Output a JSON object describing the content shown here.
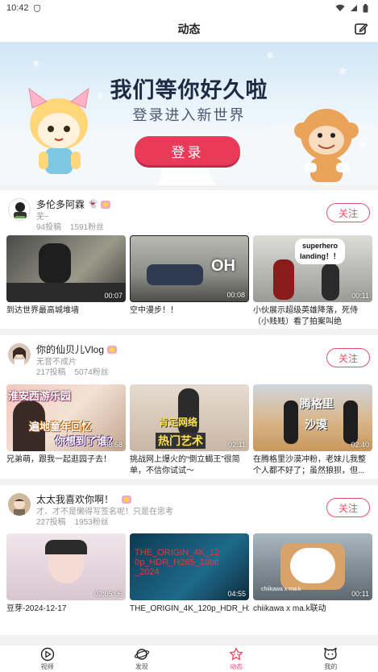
{
  "status": {
    "time": "10:42"
  },
  "header": {
    "title": "动态"
  },
  "banner": {
    "headline": "我们等你好久啦",
    "subline": "登录进入新世界",
    "login_label": "登录"
  },
  "cards": [
    {
      "name": "多伦多阿霖",
      "signature": "芜~",
      "posts": "94投稿",
      "fans": "1591粉丝",
      "follow": "关注",
      "videos": [
        {
          "duration": "00:07",
          "title": "到达世界最高城堆墙"
        },
        {
          "duration": "00:08",
          "title": "空中漫步！！",
          "overlay": "OH"
        },
        {
          "duration": "00:11",
          "title": "小伙展示超级英雄降落，死侍（小贱贱）看了拍案叫绝",
          "overlay": "superhero landing！！"
        }
      ]
    },
    {
      "name": "你的仙贝儿Vlog",
      "signature": "无音不成片",
      "posts": "217投稿",
      "fans": "5074粉丝",
      "follow": "关注",
      "videos": [
        {
          "duration": "03:58",
          "title": "兄弟萌，跟我一起逛园子去！",
          "overlay": "淮安西游乐园",
          "overlay2": "遍地童年回忆",
          "overlay3": "你想到了谁？"
        },
        {
          "duration": "02:11",
          "title": "挑战网上爆火的“倒立蝎王”很简单，不信你试试～",
          "overlay": "肯定网络",
          "overlay2": "热门艺术"
        },
        {
          "duration": "02:40",
          "title": "在腾格里沙漠冲粉，老妹儿我整个人都不好了；虽然狼狈，但...",
          "overlay": "腾格里",
          "overlay2": "沙漠"
        }
      ]
    },
    {
      "name": "太太我喜欢你啊！",
      "signature": "才、才不是懒得写签名呢！只是在思考",
      "posts": "227投稿",
      "fans": "1953粉丝",
      "follow": "关注",
      "videos": [
        {
          "duration": "02:05:06",
          "title": "豆芽-2024-12-17"
        },
        {
          "duration": "04:55",
          "title": "THE_ORIGIN_4K_120p_HDR_H265_10bit_2024",
          "overlay": "THE_ORIGIN_4K_12\n0p_HDR_H265_10bit\n_2024"
        },
        {
          "duration": "00:11",
          "title": "chiikawa x ma.k联动",
          "overlay": "chiikawa x ma.k"
        }
      ]
    }
  ],
  "nav": [
    {
      "label": "视频",
      "icon": "video-play-icon"
    },
    {
      "label": "发现",
      "icon": "planet-icon"
    },
    {
      "label": "动态",
      "icon": "star-icon",
      "active": true
    },
    {
      "label": "我的",
      "icon": "mascot-face-icon"
    }
  ],
  "colors": {
    "accent": "#ea3a5a",
    "follow": "#ec4e6a",
    "bg": "#f2f2f2"
  }
}
